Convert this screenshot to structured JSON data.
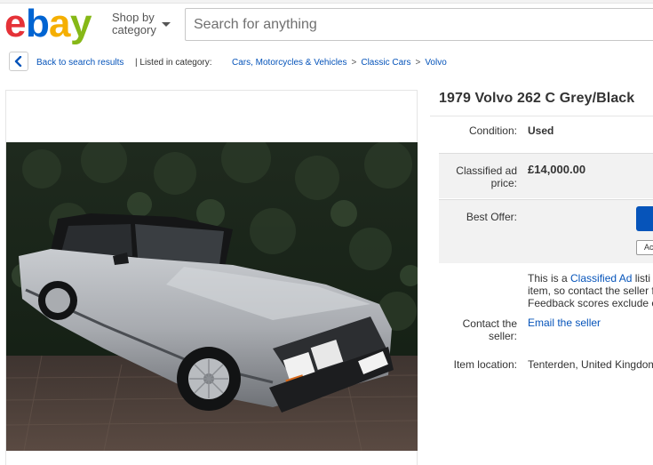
{
  "header": {
    "logo_text": "ebay",
    "shop_by_line1": "Shop by",
    "shop_by_line2": "category",
    "search_placeholder": "Search for anything"
  },
  "breadcrumb": {
    "back_label": "Back to search results",
    "listed_label": "| Listed in category:",
    "items": [
      "Cars, Motorcycles & Vehicles",
      "Classic Cars",
      "Volvo"
    ],
    "separator": ">"
  },
  "listing": {
    "title": "1979 Volvo 262 C Grey/Black",
    "condition_label": "Condition:",
    "condition_value": "Used",
    "price_label": "Classified ad price:",
    "price_value": "£14,000.00",
    "best_offer_label": "Best Offer:",
    "best_offer_secondary": "Ac",
    "classified_note_line1_prefix": "This is a ",
    "classified_note_link": "Classified Ad",
    "classified_note_line1_suffix": " listi",
    "classified_note_line2": "item, so contact the seller f",
    "classified_note_line3": "Feedback scores exclude c",
    "contact_label": "Contact the seller:",
    "contact_value": "Email the seller",
    "location_label": "Item location:",
    "location_value": "Tenterden, United Kingdom"
  },
  "colors": {
    "ebay_e": "#e53238",
    "ebay_b": "#0064d2",
    "ebay_a": "#f5af02",
    "ebay_y": "#86b817",
    "link": "#0654ba"
  }
}
